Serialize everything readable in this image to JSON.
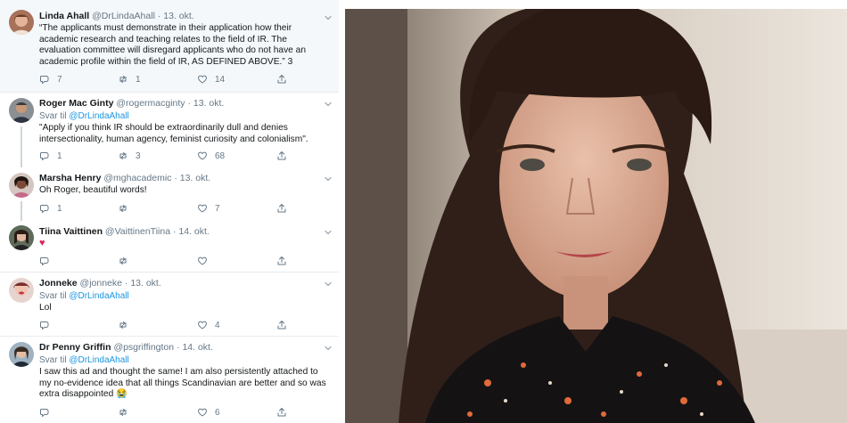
{
  "colors": {
    "accent": "#1b95e0",
    "heart": "#e0245e",
    "muted": "#657786",
    "highlight_bg": "#f5f8fa"
  },
  "tweets": [
    {
      "name": "Linda Ahall",
      "handle": "@DrLindaAhall",
      "time": "13. okt.",
      "text": "“The applicants must demonstrate in their application how their academic research and teaching relates to the field of IR. The evaluation committee will disregard applicants who do not have an academic profile within the field of IR, AS DEFINED ABOVE.” 3",
      "reply_count": "7",
      "retweet_count": "1",
      "like_count": "14"
    },
    {
      "name": "Roger Mac Ginty",
      "handle": "@rogermacginty",
      "time": "13. okt.",
      "reply_prefix": "Svar til",
      "reply_to": "@DrLindaAhall",
      "text": "\"Apply if you think IR should be extraordinarily dull and denies intersectionality, human agency, feminist curiosity and colonialism\".",
      "reply_count": "1",
      "retweet_count": "3",
      "like_count": "68"
    },
    {
      "name": "Marsha Henry",
      "handle": "@mghacademic",
      "time": "13. okt.",
      "text": "Oh Roger, beautiful words!",
      "reply_count": "1",
      "retweet_count": "",
      "like_count": "7"
    },
    {
      "name": "Tiina Vaittinen",
      "handle": "@VaittinenTiina",
      "time": "14. okt.",
      "text": "♥",
      "reply_count": "",
      "retweet_count": "",
      "like_count": ""
    },
    {
      "name": "Jonneke",
      "handle": "@jonneke",
      "time": "13. okt.",
      "reply_prefix": "Svar til",
      "reply_to": "@DrLindaAhall",
      "text": "Lol",
      "reply_count": "",
      "retweet_count": "",
      "like_count": "4"
    },
    {
      "name": "Dr Penny Griffin",
      "handle": "@psgriffington",
      "time": "14. okt.",
      "reply_prefix": "Svar til",
      "reply_to": "@DrLindaAhall",
      "text": "I saw this ad and thought the same! I am also persistently attached to my no-evidence idea that all things Scandinavian are better and so was extra disappointed 😭",
      "reply_count": "",
      "retweet_count": "",
      "like_count": "6"
    }
  ]
}
